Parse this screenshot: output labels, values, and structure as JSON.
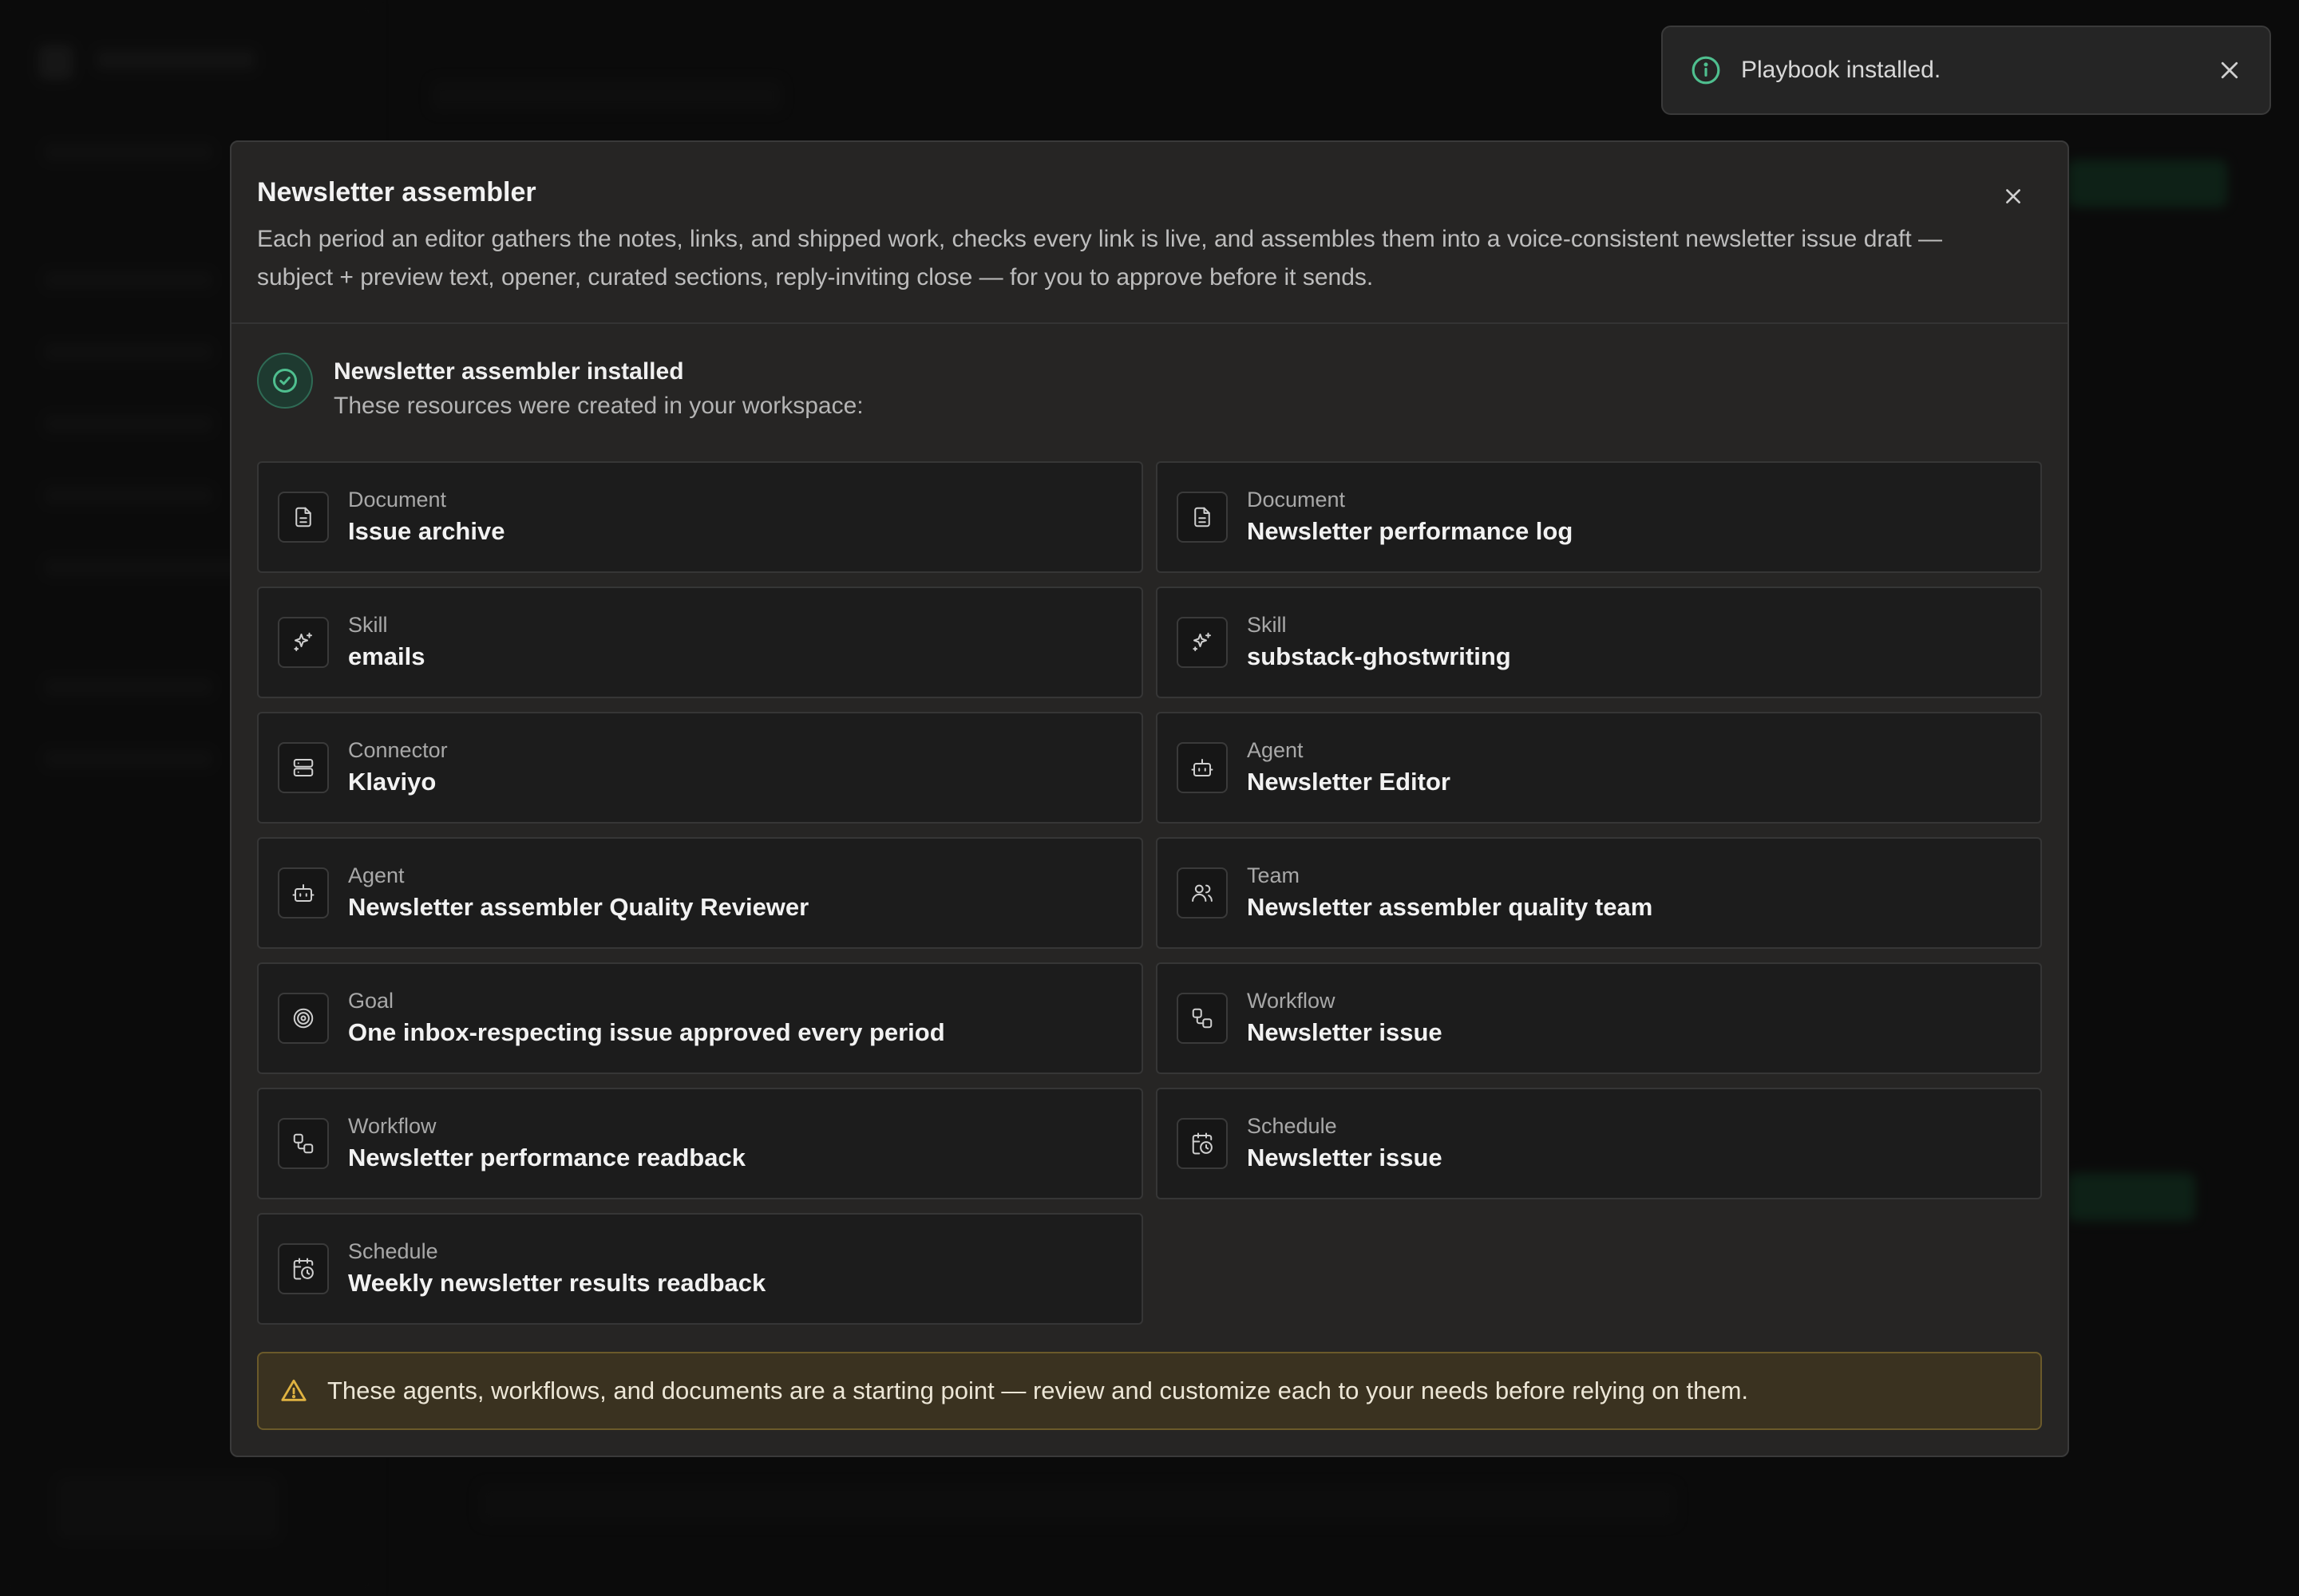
{
  "toast": {
    "message": "Playbook installed.",
    "icon": "info-icon",
    "close_icon": "close-icon"
  },
  "modal": {
    "title": "Newsletter assembler",
    "description": "Each period an editor gathers the notes, links, and shipped work, checks every link is live, and assembles them into a voice-consistent newsletter issue draft — subject + preview text, opener, curated sections, reply-inviting close — for you to approve before it sends.",
    "close_icon": "close-icon",
    "success": {
      "icon": "check-circle-icon",
      "title": "Newsletter assembler installed",
      "subtitle": "These resources were created in your workspace:"
    },
    "resources": [
      {
        "type": "Document",
        "name": "Issue archive",
        "icon": "document-icon"
      },
      {
        "type": "Document",
        "name": "Newsletter performance log",
        "icon": "document-icon"
      },
      {
        "type": "Skill",
        "name": "emails",
        "icon": "sparkles-icon"
      },
      {
        "type": "Skill",
        "name": "substack-ghostwriting",
        "icon": "sparkles-icon"
      },
      {
        "type": "Connector",
        "name": "Klaviyo",
        "icon": "server-icon"
      },
      {
        "type": "Agent",
        "name": "Newsletter Editor",
        "icon": "bot-icon"
      },
      {
        "type": "Agent",
        "name": "Newsletter assembler Quality Reviewer",
        "icon": "bot-icon"
      },
      {
        "type": "Team",
        "name": "Newsletter assembler quality team",
        "icon": "users-icon"
      },
      {
        "type": "Goal",
        "name": "One inbox-respecting issue approved every period",
        "icon": "target-icon"
      },
      {
        "type": "Workflow",
        "name": "Newsletter issue",
        "icon": "workflow-icon"
      },
      {
        "type": "Workflow",
        "name": "Newsletter performance readback",
        "icon": "workflow-icon"
      },
      {
        "type": "Schedule",
        "name": "Newsletter issue",
        "icon": "calendar-clock-icon"
      },
      {
        "type": "Schedule",
        "name": "Weekly newsletter results readback",
        "icon": "calendar-clock-icon"
      }
    ],
    "warning": {
      "icon": "warning-triangle-icon",
      "text": "These agents, workflows, and documents are a starting point — review and customize each to your needs before relying on them."
    }
  },
  "colors": {
    "background": "#141414",
    "modal": "#262524",
    "card": "#1c1c1c",
    "success_accent": "#4fbf8f",
    "warning_accent": "#e0b341",
    "warning_bg": "#3a3220"
  }
}
